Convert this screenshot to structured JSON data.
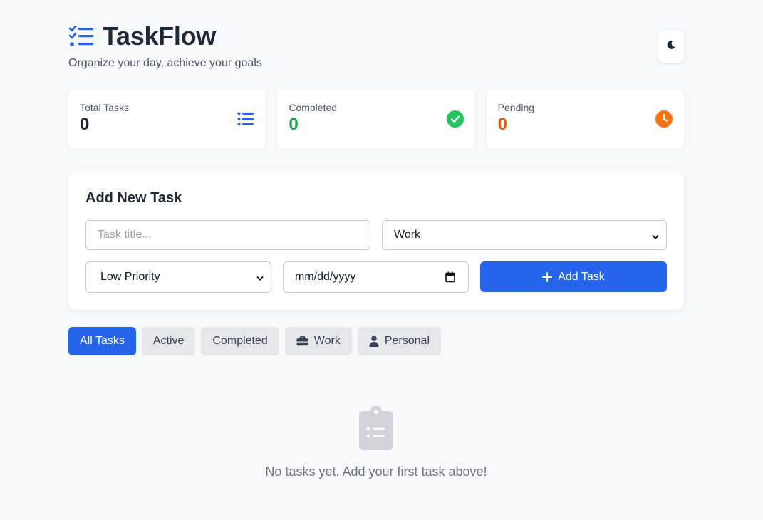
{
  "header": {
    "title": "TaskFlow",
    "subtitle": "Organize your day, achieve your goals",
    "brand_icon": "checklist-icon",
    "theme_toggle_icon": "moon-icon"
  },
  "stats": [
    {
      "label": "Total Tasks",
      "value": "0",
      "icon": "list-icon",
      "color": "#2563eb"
    },
    {
      "label": "Completed",
      "value": "0",
      "icon": "check-circle-icon",
      "color": "#16a34a"
    },
    {
      "label": "Pending",
      "value": "0",
      "icon": "clock-icon",
      "color": "#ea580c"
    }
  ],
  "add_task": {
    "title": "Add New Task",
    "title_placeholder": "Task title...",
    "category_selected": "Work",
    "priority_selected": "Low Priority",
    "date_placeholder": "mm/dd/yyyy",
    "button_label": "Add Task"
  },
  "filters": [
    {
      "label": "All Tasks",
      "active": true
    },
    {
      "label": "Active",
      "active": false
    },
    {
      "label": "Completed",
      "active": false
    },
    {
      "label": "Work",
      "icon": "briefcase-icon",
      "active": false
    },
    {
      "label": "Personal",
      "icon": "user-icon",
      "active": false
    }
  ],
  "empty_state": {
    "icon": "clipboard-list-icon",
    "message": "No tasks yet. Add your first task above!"
  },
  "colors": {
    "accent": "#2563eb",
    "completed": "#16a34a",
    "pending": "#ea580c",
    "background": "#f8f9fb"
  }
}
